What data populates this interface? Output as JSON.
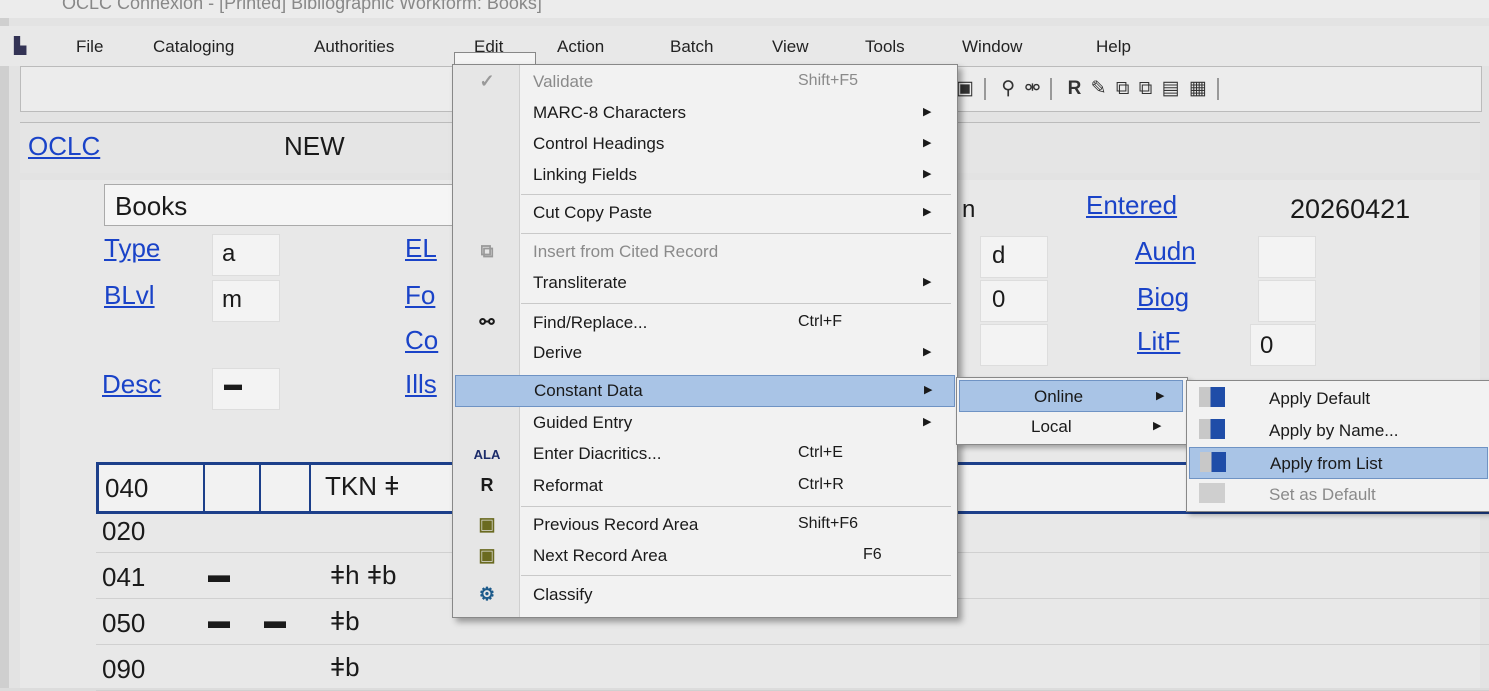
{
  "window": {
    "title": "OCLC Connexion - [Printed] Bibliographic Workform: Books]"
  },
  "menubar": {
    "items": [
      "File",
      "Cataloging",
      "Authorities",
      "Edit",
      "Action",
      "Batch",
      "View",
      "Tools",
      "Window",
      "Help"
    ]
  },
  "toolbar": {
    "icons": [
      "validate-icon",
      "find-icon",
      "find-next-icon",
      "reformat-icon",
      "control-headings-icon",
      "copy-icon",
      "paste-icon",
      "classify-icon",
      "list-icon"
    ],
    "reformat_glyph": "R"
  },
  "record": {
    "oclc_label": "OCLC",
    "oclc_value": "NEW",
    "workform": "Books",
    "fields": {
      "type": {
        "label": "Type",
        "value": "a"
      },
      "blvl": {
        "label": "BLvl",
        "value": "m"
      },
      "desc": {
        "label": "Desc",
        "value": "▬"
      },
      "el": {
        "label": "EL"
      },
      "form": {
        "label": "Fo"
      },
      "cont": {
        "label": "Co"
      },
      "ills": {
        "label": "Ills"
      },
      "srce_val": "d",
      "conf_val": "0",
      "lang_partial": "n",
      "entered": {
        "label": "Entered",
        "value": "20260421"
      },
      "audn": {
        "label": "Audn",
        "value": ""
      },
      "biog": {
        "label": "Biog",
        "value": ""
      },
      "litf": {
        "label": "LitF",
        "value": "0"
      }
    },
    "marc_rows": [
      {
        "tag": "040",
        "ind1": "",
        "ind2": "",
        "content": "TKN ǂ"
      },
      {
        "tag": "020",
        "ind1": "",
        "ind2": "",
        "content": ""
      },
      {
        "tag": "041",
        "ind1": "▬",
        "ind2": "",
        "content": "ǂh ǂb"
      },
      {
        "tag": "050",
        "ind1": "▬",
        "ind2": "▬",
        "content": "ǂb"
      },
      {
        "tag": "090",
        "ind1": "",
        "ind2": "",
        "content": "ǂb"
      }
    ]
  },
  "edit_menu": {
    "items": [
      {
        "label": "Validate",
        "shortcut": "Shift+F5",
        "disabled": true,
        "icon": "validate-icon"
      },
      {
        "label": "MARC-8 Characters",
        "submenu": true
      },
      {
        "label": "Control Headings",
        "submenu": true
      },
      {
        "label": "Linking Fields",
        "submenu": true
      },
      {
        "label": "Cut Copy Paste",
        "submenu": true
      },
      {
        "label": "Insert from Cited Record",
        "disabled": true,
        "icon": "insert-cited-icon"
      },
      {
        "label": "Transliterate",
        "submenu": true
      },
      {
        "label": "Find/Replace...",
        "shortcut": "Ctrl+F",
        "icon": "binoculars-icon"
      },
      {
        "label": "Derive",
        "submenu": true
      },
      {
        "label": "Constant Data",
        "submenu": true,
        "highlighted": true
      },
      {
        "label": "Guided Entry",
        "submenu": true
      },
      {
        "label": "Enter Diacritics...",
        "shortcut": "Ctrl+E",
        "icon": "ala-icon",
        "icon_text": "ALA"
      },
      {
        "label": "Reformat",
        "shortcut": "Ctrl+R",
        "icon": "reformat-icon",
        "icon_text": "R"
      },
      {
        "label": "Previous Record Area",
        "shortcut": "Shift+F6",
        "icon": "previous-area-icon"
      },
      {
        "label": "Next Record Area",
        "shortcut": "F6",
        "icon": "next-area-icon"
      },
      {
        "label": "Classify",
        "icon": "classify-icon"
      }
    ]
  },
  "constant_data_submenu": {
    "items": [
      {
        "label": "Online",
        "highlighted": true
      },
      {
        "label": "Local"
      }
    ]
  },
  "online_submenu": {
    "items": [
      {
        "label": "Apply Default",
        "icon": "apply-default-icon"
      },
      {
        "label": "Apply by Name...",
        "icon": "apply-by-name-icon"
      },
      {
        "label": "Apply from List",
        "icon": "apply-from-list-icon",
        "highlighted": true
      },
      {
        "label": "Set as Default",
        "icon": "set-default-icon",
        "disabled": true
      }
    ]
  },
  "colors": {
    "link": "#1a43c8",
    "highlight": "#a9c4e6",
    "row_border": "#1c3f8a"
  }
}
